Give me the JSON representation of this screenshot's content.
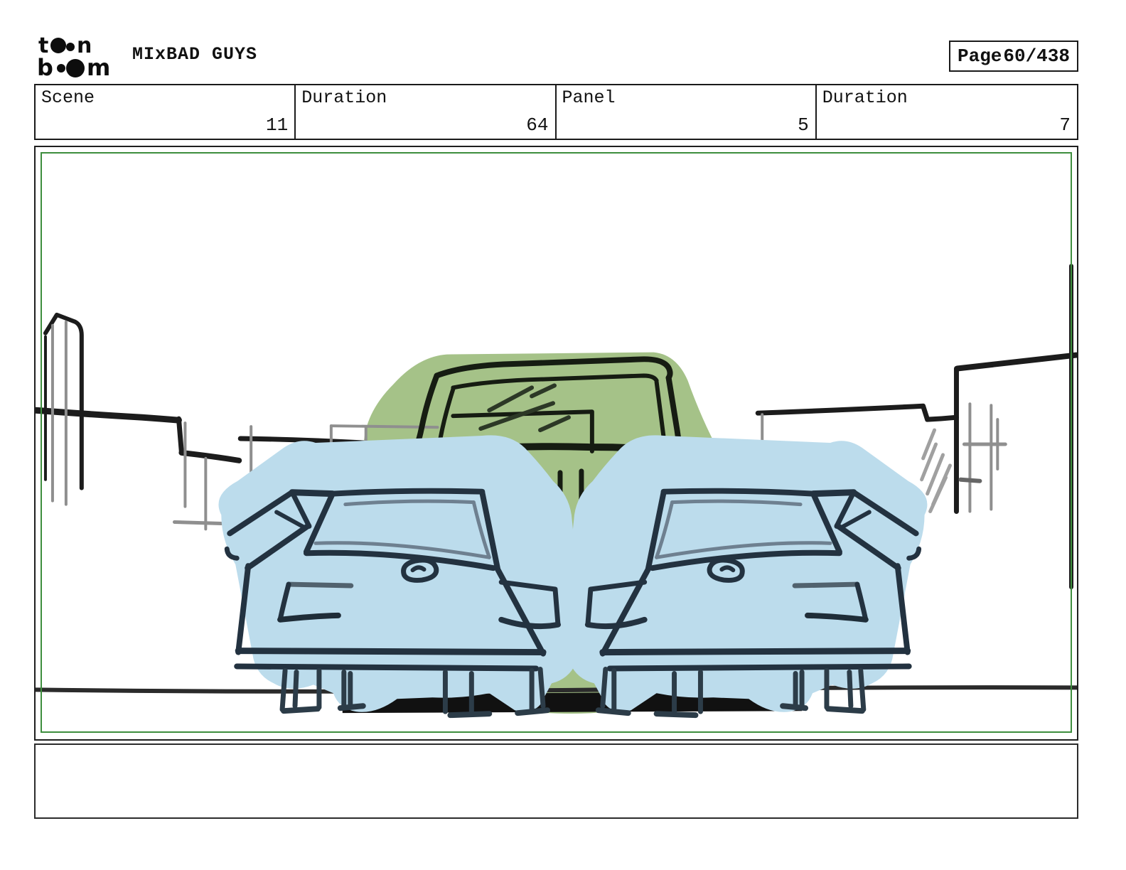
{
  "header": {
    "logo": {
      "word1": "t..n",
      "word2": "b..m",
      "brand": "toon boom",
      "letters": [
        "t",
        "n",
        "b",
        "m"
      ]
    },
    "title": "MIxBAD GUYS",
    "page_label": "Page",
    "page_value": "60/438"
  },
  "info_row": {
    "cells": [
      {
        "label": "Scene",
        "value": "11"
      },
      {
        "label": "Duration",
        "value": "64"
      },
      {
        "label": "Panel",
        "value": "5"
      },
      {
        "label": "Duration",
        "value": "7"
      }
    ]
  },
  "panel": {
    "description": "Hand-drawn storyboard sketch: green car front view centered behind two light-blue cars seen from the rear, city skyline sketched in background, road line across bottom",
    "colors": {
      "camera_frame_green": "#3e8e3e",
      "car_green_fill": "#a5c288",
      "car_blue_fill": "#bcdcec",
      "blue_outline": "#233240",
      "sketch_black": "#1c1c1c",
      "sketch_grey": "#8f8f8f",
      "road_line": "#2b2b2b"
    }
  },
  "caption": {
    "text": ""
  }
}
